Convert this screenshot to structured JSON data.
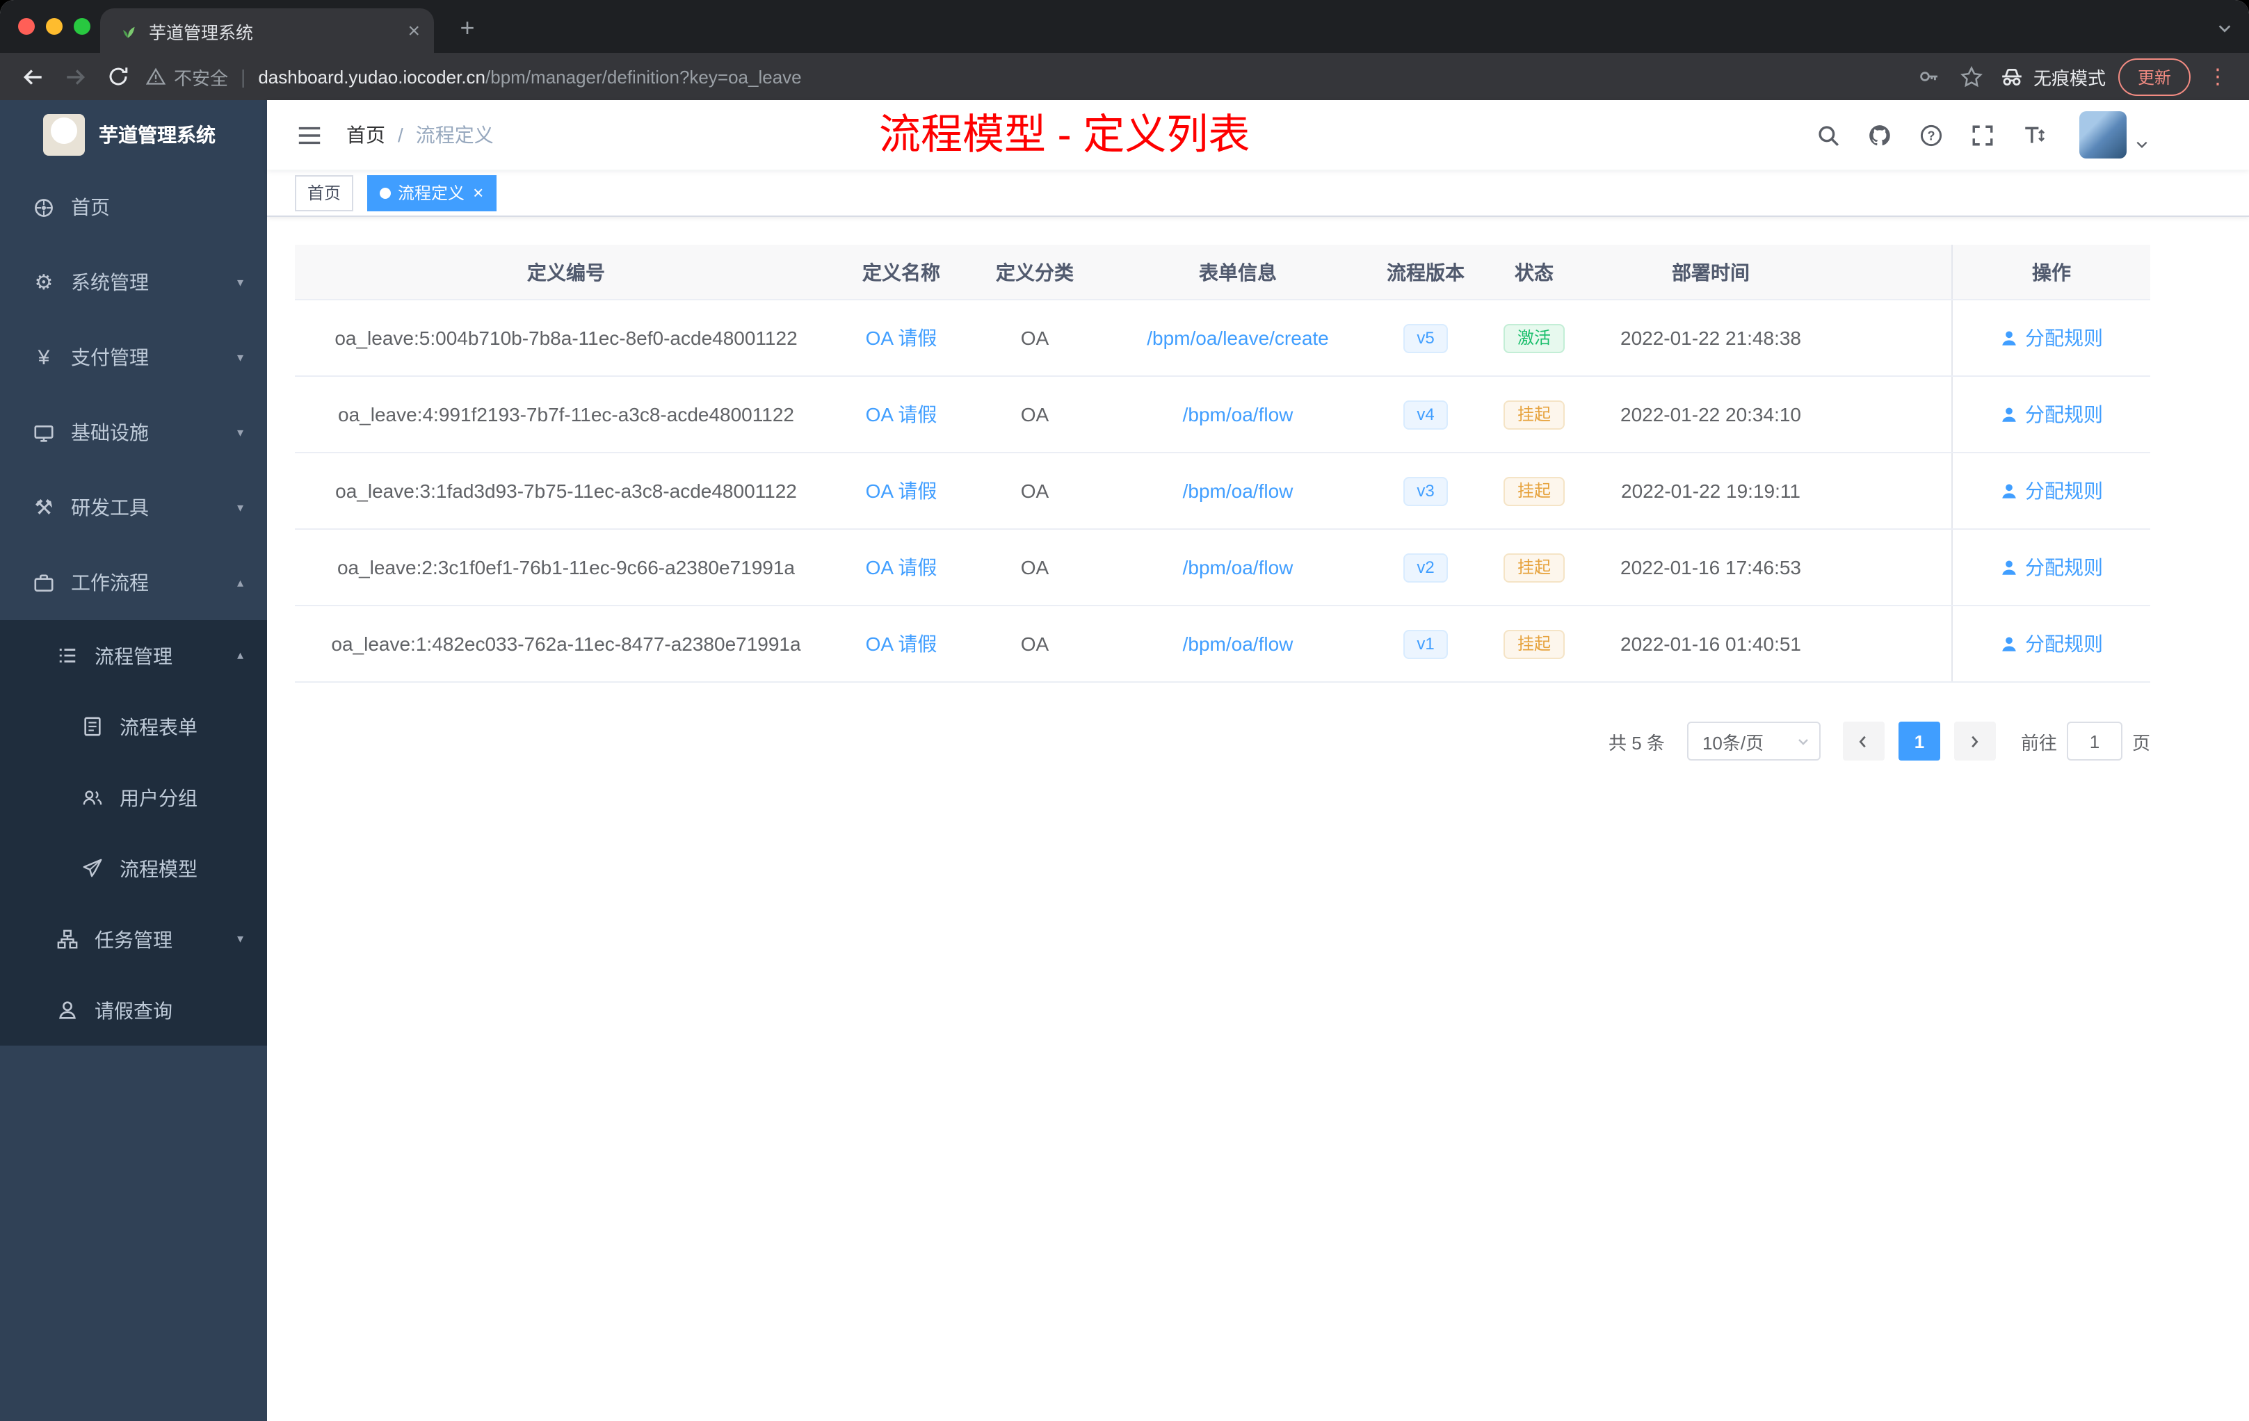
{
  "browser": {
    "tab_title": "芋道管理系统",
    "security_label": "不安全",
    "url_host": "dashboard.yudao.iocoder.cn",
    "url_path": "/bpm/manager/definition?key=oa_leave",
    "incognito_label": "无痕模式",
    "update_label": "更新"
  },
  "sidebar": {
    "logo_title": "芋道管理系统",
    "items": [
      {
        "label": "首页",
        "icon": "dashboard-icon"
      },
      {
        "label": "系统管理",
        "icon": "gear-icon"
      },
      {
        "label": "支付管理",
        "icon": "yen-icon"
      },
      {
        "label": "基础设施",
        "icon": "monitor-icon"
      },
      {
        "label": "研发工具",
        "icon": "tools-icon"
      },
      {
        "label": "工作流程",
        "icon": "briefcase-icon"
      },
      {
        "label": "流程管理",
        "icon": "list-icon"
      },
      {
        "label": "流程表单",
        "icon": "document-icon"
      },
      {
        "label": "用户分组",
        "icon": "users-icon"
      },
      {
        "label": "流程模型",
        "icon": "send-icon"
      },
      {
        "label": "任务管理",
        "icon": "tree-icon"
      },
      {
        "label": "请假查询",
        "icon": "person-icon"
      }
    ]
  },
  "navbar": {
    "breadcrumb_home": "首页",
    "breadcrumb_separator": "/",
    "breadcrumb_current": "流程定义",
    "annotation": "流程模型 - 定义列表"
  },
  "tags": {
    "home": "首页",
    "current": "流程定义"
  },
  "table": {
    "columns": [
      "定义编号",
      "定义名称",
      "定义分类",
      "表单信息",
      "流程版本",
      "状态",
      "部署时间",
      "操作"
    ],
    "rows": [
      {
        "id": "oa_leave:5:004b710b-7b8a-11ec-8ef0-acde48001122",
        "name": "OA 请假",
        "category": "OA",
        "form": "/bpm/oa/leave/create",
        "version": "v5",
        "status": "激活",
        "time": "2022-01-22 21:48:38",
        "action": "分配规则"
      },
      {
        "id": "oa_leave:4:991f2193-7b7f-11ec-a3c8-acde48001122",
        "name": "OA 请假",
        "category": "OA",
        "form": "/bpm/oa/flow",
        "version": "v4",
        "status": "挂起",
        "time": "2022-01-22 20:34:10",
        "action": "分配规则"
      },
      {
        "id": "oa_leave:3:1fad3d93-7b75-11ec-a3c8-acde48001122",
        "name": "OA 请假",
        "category": "OA",
        "form": "/bpm/oa/flow",
        "version": "v3",
        "status": "挂起",
        "time": "2022-01-22 19:19:11",
        "action": "分配规则"
      },
      {
        "id": "oa_leave:2:3c1f0ef1-76b1-11ec-9c66-a2380e71991a",
        "name": "OA 请假",
        "category": "OA",
        "form": "/bpm/oa/flow",
        "version": "v2",
        "status": "挂起",
        "time": "2022-01-16 17:46:53",
        "action": "分配规则"
      },
      {
        "id": "oa_leave:1:482ec033-762a-11ec-8477-a2380e71991a",
        "name": "OA 请假",
        "category": "OA",
        "form": "/bpm/oa/flow",
        "version": "v1",
        "status": "挂起",
        "time": "2022-01-16 01:40:51",
        "action": "分配规则"
      }
    ]
  },
  "pagination": {
    "total": "共 5 条",
    "page_size": "10条/页",
    "page": "1",
    "goto_label": "前往",
    "goto_value": "1",
    "goto_unit": "页"
  },
  "colors": {
    "accent": "#409eff",
    "success": "#19be6b",
    "warning": "#e6a23c",
    "annotation": "#fe0000",
    "sidebar_bg": "#304156",
    "submenu_bg": "#1f2d3d"
  }
}
